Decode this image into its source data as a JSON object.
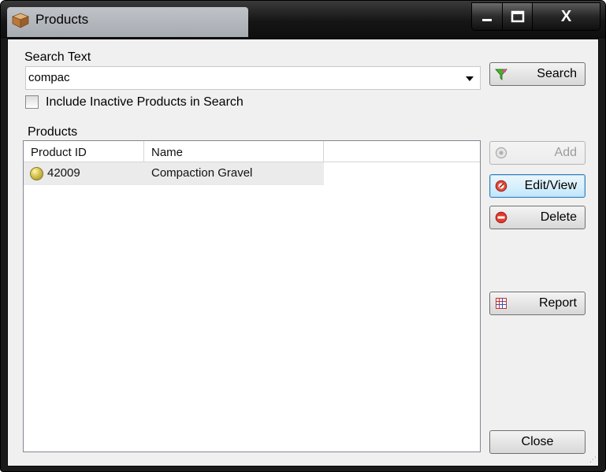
{
  "window": {
    "title": "Products",
    "controls": {
      "minimize": "minimize",
      "maximize": "maximize",
      "close": "X"
    }
  },
  "search": {
    "label": "Search Text",
    "value": "compac",
    "button_label": "Search",
    "include_inactive_label": "Include Inactive Products in Search",
    "include_inactive_checked": false
  },
  "products": {
    "label": "Products",
    "columns": [
      "Product ID",
      "Name"
    ],
    "rows": [
      {
        "status": "yellow-circle-icon",
        "product_id": "42009",
        "name": "Compaction Gravel"
      }
    ]
  },
  "actions": {
    "add": {
      "label": "Add",
      "enabled": false
    },
    "edit_view": {
      "label": "Edit/View",
      "enabled": true
    },
    "delete": {
      "label": "Delete",
      "enabled": true
    },
    "report": {
      "label": "Report",
      "enabled": true
    },
    "close": {
      "label": "Close",
      "enabled": true
    }
  }
}
